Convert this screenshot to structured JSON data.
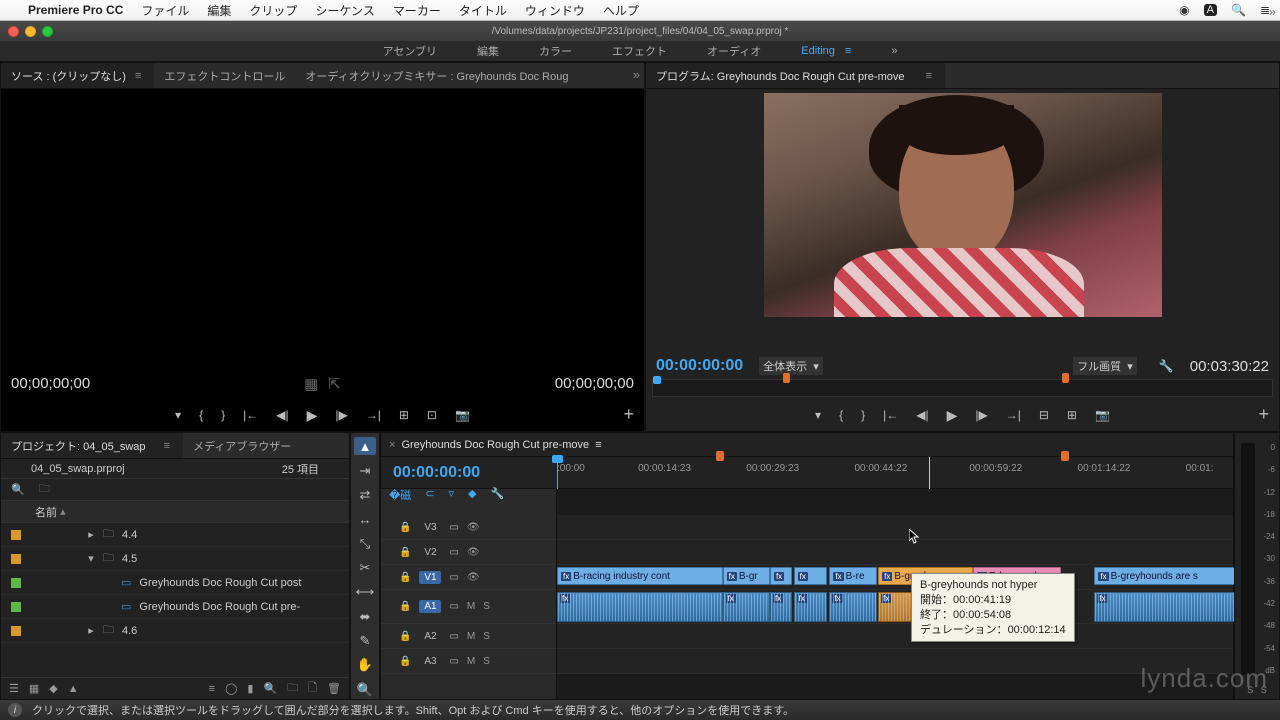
{
  "mac_menu": {
    "app": "Premiere Pro CC",
    "items": [
      "ファイル",
      "編集",
      "クリップ",
      "シーケンス",
      "マーカー",
      "タイトル",
      "ウィンドウ",
      "ヘルプ"
    ]
  },
  "title_path": "/Volumes/data/projects/JP231/project_files/04/04_05_swap.prproj *",
  "workspaces": [
    "アセンブリ",
    "編集",
    "カラー",
    "エフェクト",
    "オーディオ",
    "Editing"
  ],
  "source": {
    "tabs": [
      "ソース : (クリップなし)",
      "エフェクトコントロール",
      "オーディオクリップミキサー : Greyhounds Doc Roug"
    ],
    "tc_left": "00;00;00;00",
    "tc_right": "00;00;00;00"
  },
  "program": {
    "title": "プログラム: Greyhounds Doc Rough Cut pre-move",
    "tc": "00:00:00:00",
    "fit": "全体表示",
    "quality": "フル画質",
    "duration": "00:03:30:22"
  },
  "project": {
    "tab1": "プロジェクト: 04_05_swap",
    "tab2": "メディアブラウザー",
    "file": "04_05_swap.prproj",
    "count": "25 項目",
    "col_name": "名前",
    "rows": [
      {
        "type": "folder",
        "label": "4.4",
        "level": 1,
        "open": false,
        "sw": "o"
      },
      {
        "type": "folder",
        "label": "4.5",
        "level": 1,
        "open": true,
        "sw": "o"
      },
      {
        "type": "seq",
        "label": "Greyhounds Doc Rough Cut post",
        "level": 2,
        "sw": "g"
      },
      {
        "type": "seq",
        "label": "Greyhounds Doc Rough Cut pre-",
        "level": 2,
        "sw": "g"
      },
      {
        "type": "folder",
        "label": "4.6",
        "level": 1,
        "open": false,
        "sw": "o"
      }
    ]
  },
  "timeline": {
    "title": "Greyhounds Doc Rough Cut pre-move",
    "tc": "00:00:00:00",
    "ruler": [
      ":00:00",
      "00:00:14:23",
      "00:00:29:23",
      "00:00:44:22",
      "00:00:59:22",
      "00:01:14:22",
      "00:01:"
    ],
    "marker_positions": [
      23.5,
      74.5
    ],
    "tracks_v": [
      "V3",
      "V2",
      "V1"
    ],
    "tracks_a": [
      "A1",
      "A2",
      "A3"
    ],
    "clips_v1": [
      {
        "l": 0,
        "w": 24.5,
        "label": "B-racing industry cont",
        "cls": "v"
      },
      {
        "l": 24.5,
        "w": 7,
        "label": "B-gr",
        "cls": "v"
      },
      {
        "l": 31.5,
        "w": 3.2,
        "label": "",
        "cls": "v"
      },
      {
        "l": 35,
        "w": 5,
        "label": "",
        "cls": "v"
      },
      {
        "l": 40.3,
        "w": 7,
        "label": "B-re",
        "cls": "v"
      },
      {
        "l": 47.5,
        "w": 14,
        "label": "B-greyhour",
        "cls": "v sel"
      },
      {
        "l": 61.5,
        "w": 13,
        "label": "R-lazy and",
        "cls": "v pink"
      },
      {
        "l": 79.5,
        "w": 21,
        "label": "B-greyhounds are s",
        "cls": "v"
      }
    ],
    "clips_a1": [
      {
        "l": 0,
        "w": 24.5,
        "cls": ""
      },
      {
        "l": 24.5,
        "w": 7,
        "cls": ""
      },
      {
        "l": 31.5,
        "w": 3.2,
        "cls": ""
      },
      {
        "l": 35,
        "w": 5,
        "cls": ""
      },
      {
        "l": 40.3,
        "w": 7,
        "cls": ""
      },
      {
        "l": 47.5,
        "w": 14,
        "cls": "sel"
      },
      {
        "l": 61.5,
        "w": 13,
        "cls": ""
      },
      {
        "l": 79.5,
        "w": 21,
        "cls": ""
      }
    ]
  },
  "tooltip": {
    "name": "B-greyhounds not hyper",
    "start_label": "開始：",
    "start": "00:00:41:19",
    "end_label": "終了：",
    "end": "00:00:54:08",
    "dur_label": "デュレーション：",
    "dur": "00:00:12:14"
  },
  "meter_ticks": [
    "0",
    "-6",
    "-12",
    "-18",
    "-24",
    "-30",
    "-36",
    "-42",
    "-48",
    "-54",
    "dB"
  ],
  "status_text": "クリックで選択、または選択ツールをドラッグして囲んだ部分を選択します。Shift、Opt および Cmd キーを使用すると、他のオプションを使用できます。",
  "watermark": "lynda.com"
}
